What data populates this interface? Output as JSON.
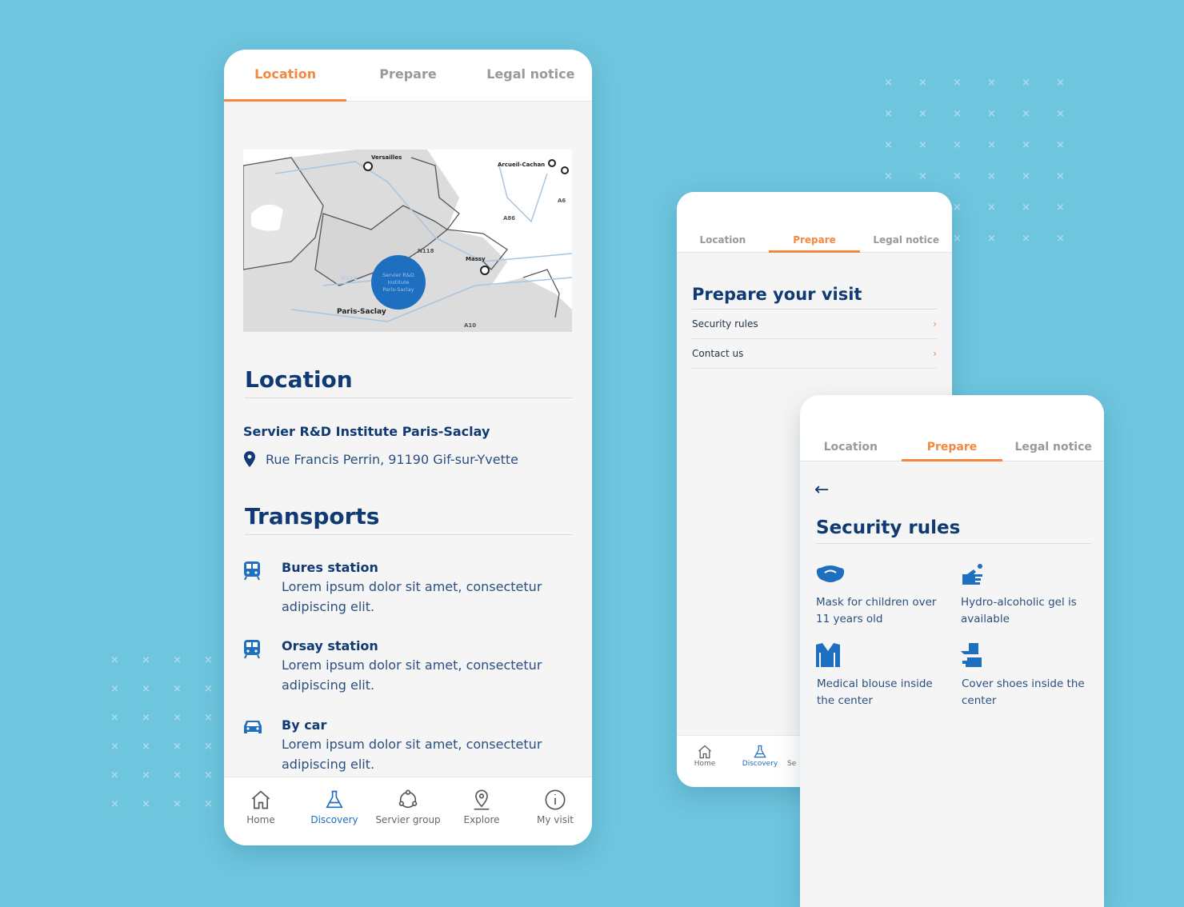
{
  "colors": {
    "background": "#6ec5de",
    "accent": "#f5873f",
    "navy": "#0f3a73",
    "blue": "#1e6fbf"
  },
  "tabs": [
    "Location",
    "Prepare",
    "Legal notice"
  ],
  "phone1": {
    "active_tab": "Location",
    "map": {
      "labels": [
        "Versailles",
        "Arcueil-Cachan",
        "A6",
        "A86",
        "N118",
        "Massy",
        "N118",
        "Paris-Saclay",
        "A10"
      ],
      "marker": [
        "Servier R&D",
        "Institute",
        "Paris-Saclay"
      ]
    },
    "location_title": "Location",
    "institute": "Servier R&D Institute Paris-Saclay",
    "address": "Rue Francis Perrin, 91190 Gif-sur-Yvette",
    "transports_title": "Transports",
    "transports": [
      {
        "icon": "train-icon",
        "title": "Bures station",
        "desc": "Lorem ipsum dolor sit amet, consectetur adipiscing elit."
      },
      {
        "icon": "train-icon",
        "title": "Orsay station",
        "desc": "Lorem ipsum dolor sit amet, consectetur adipiscing elit."
      },
      {
        "icon": "car-icon",
        "title": "By car",
        "desc": "Lorem ipsum dolor sit amet, consectetur adipiscing elit."
      }
    ]
  },
  "nav": [
    {
      "label": "Home",
      "icon": "home-icon"
    },
    {
      "label": "Discovery",
      "icon": "flask-icon",
      "active": true
    },
    {
      "label": "Servier group",
      "icon": "network-icon"
    },
    {
      "label": "Explore",
      "icon": "map-pin-icon"
    },
    {
      "label": "My visit",
      "icon": "info-icon"
    }
  ],
  "phone2": {
    "active_tab": "Prepare",
    "title": "Prepare your visit",
    "items": [
      "Security rules",
      "Contact us"
    ],
    "nav_partial": "Se"
  },
  "phone3": {
    "active_tab": "Prepare",
    "title": "Security rules",
    "rules": [
      {
        "icon": "mask-icon",
        "text": "Mask for children over 11 years old"
      },
      {
        "icon": "hand-gel-icon",
        "text": "Hydro-alcoholic gel is available"
      },
      {
        "icon": "blouse-icon",
        "text": "Medical blouse inside the center"
      },
      {
        "icon": "shoe-cover-icon",
        "text": "Cover shoes inside the center"
      }
    ]
  }
}
